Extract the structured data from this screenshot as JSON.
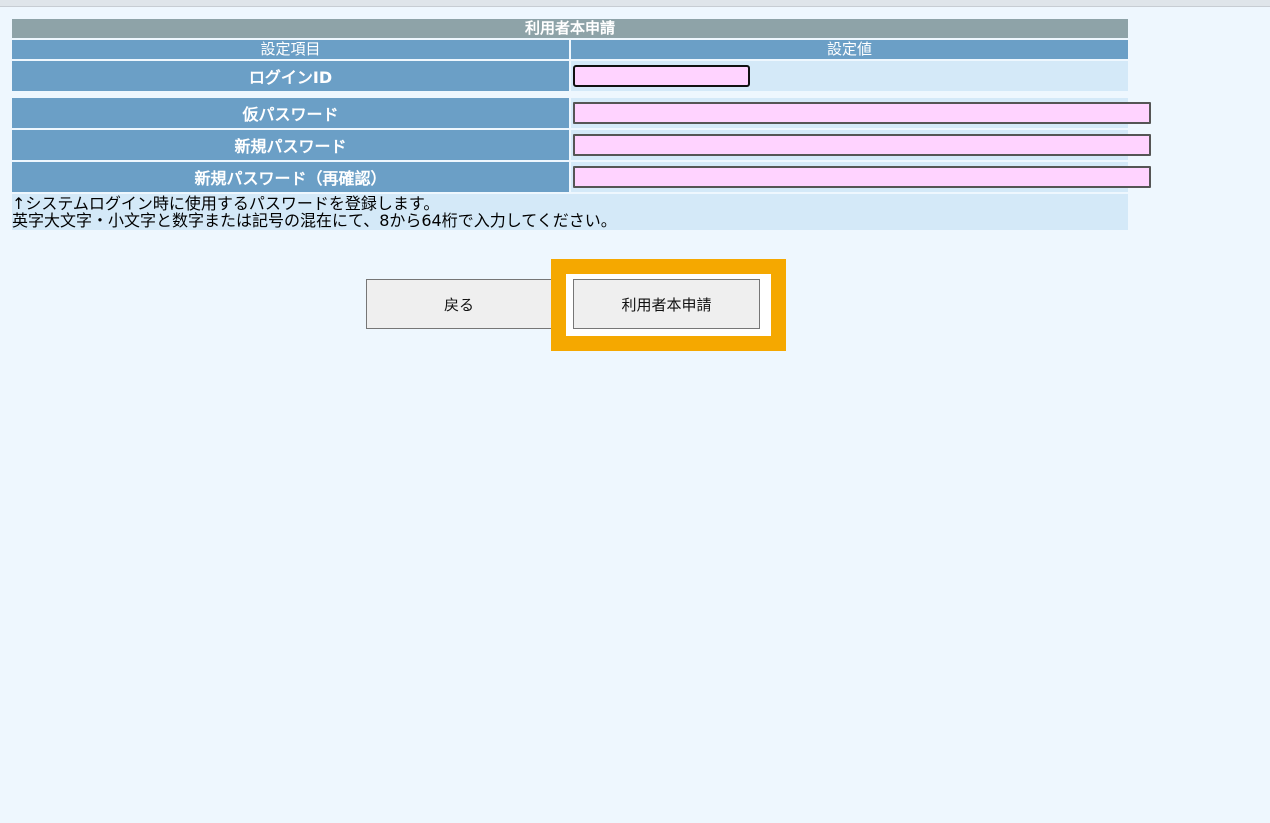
{
  "form": {
    "title": "利用者本申請",
    "header_item": "設定項目",
    "header_value": "設定値",
    "rows": [
      {
        "label": "ログインID",
        "value": ""
      },
      {
        "label": "仮パスワード",
        "value": ""
      },
      {
        "label": "新規パスワード",
        "value": ""
      },
      {
        "label": "新規パスワード（再確認）",
        "value": ""
      }
    ],
    "note_line1": "↑システムログイン時に使用するパスワードを登録します。",
    "note_line2": "英字大文字・小文字と数字または記号の混在にて、8から64桁で入力してください。"
  },
  "buttons": {
    "back_label": "戻る",
    "submit_label": "利用者本申請"
  },
  "colors": {
    "title_bg": "#8ea3a8",
    "label_bg": "#6b9fc6",
    "value_bg": "#d4e9f8",
    "input_bg": "#ffd3ff",
    "highlight": "#f5a800",
    "page_bg": "#eef7fe"
  }
}
